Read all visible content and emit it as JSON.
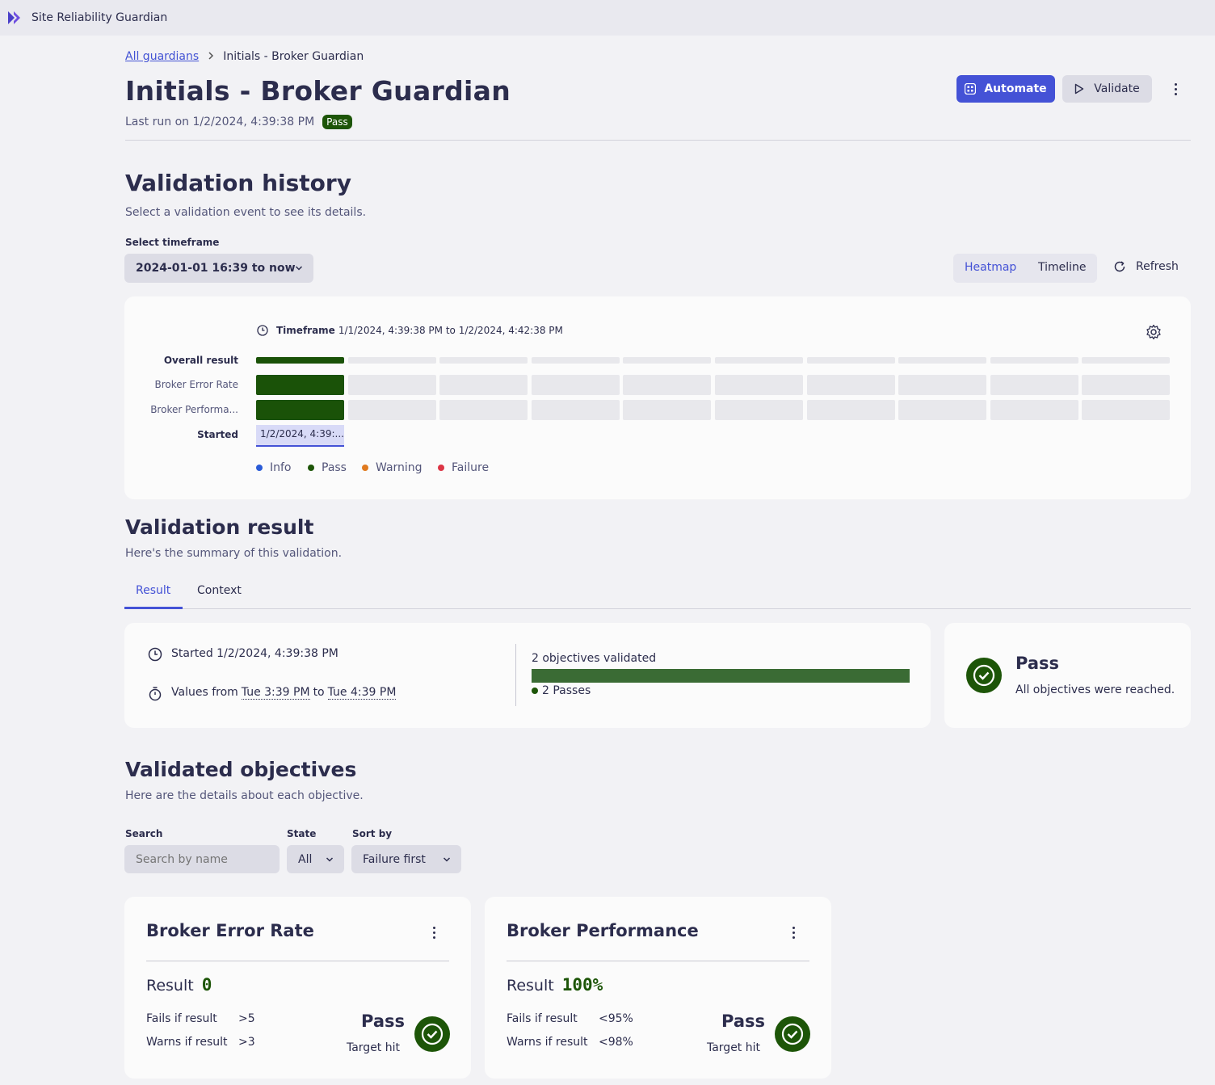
{
  "app": {
    "title": "Site Reliability Guardian"
  },
  "breadcrumb": {
    "parent": "All guardians",
    "current": "Initials - Broker Guardian"
  },
  "header": {
    "title": "Initials - Broker Guardian",
    "last_run": "Last run on 1/2/2024, 4:39:38 PM",
    "status": "Pass",
    "automate_label": "Automate",
    "validate_label": "Validate"
  },
  "history": {
    "title": "Validation history",
    "subtitle": "Select a validation event to see its details.",
    "timeframe_label": "Select timeframe",
    "timeframe_value": "2024-01-01 16:39 to now",
    "view_heatmap": "Heatmap",
    "view_timeline": "Timeline",
    "refresh": "Refresh",
    "timeframe_prefix": "Timeframe",
    "timeframe_range": "1/1/2024, 4:39:38 PM to 1/2/2024, 4:42:38 PM",
    "rows": [
      "Overall result",
      "Broker Error Rate",
      "Broker Performa..."
    ],
    "started_label": "Started",
    "started_value": "1/2/2024, 4:39:...",
    "legend": [
      {
        "label": "Info",
        "color": "#2a5bd7"
      },
      {
        "label": "Pass",
        "color": "#1d5508"
      },
      {
        "label": "Warning",
        "color": "#e07a1f"
      },
      {
        "label": "Failure",
        "color": "#dc3545"
      }
    ]
  },
  "result": {
    "title": "Validation result",
    "subtitle": "Here's the summary of this validation.",
    "tabs": [
      "Result",
      "Context"
    ],
    "started": "Started 1/2/2024, 4:39:38 PM",
    "values_prefix": "Values from",
    "values_from": "Tue 3:39 PM",
    "values_to_word": "to",
    "values_to": "Tue 4:39 PM",
    "objectives_validated": "2 objectives validated",
    "passes": "2 Passes",
    "status": "Pass",
    "status_detail": "All objectives were reached."
  },
  "objectives": {
    "title": "Validated objectives",
    "subtitle": "Here are the details about each objective.",
    "search_label": "Search",
    "search_placeholder": "Search by name",
    "state_label": "State",
    "state_value": "All",
    "sort_label": "Sort by",
    "sort_value": "Failure first",
    "items": [
      {
        "name": "Broker Error Rate",
        "result_label": "Result",
        "result_value": "0",
        "fails_label": "Fails if result",
        "fails_value": ">5",
        "warns_label": "Warns if result",
        "warns_value": ">3",
        "status": "Pass",
        "status_detail": "Target hit"
      },
      {
        "name": "Broker Performance",
        "result_label": "Result",
        "result_value": "100%",
        "fails_label": "Fails if result",
        "fails_value": "<95%",
        "warns_label": "Warns if result",
        "warns_value": "<98%",
        "status": "Pass",
        "status_detail": "Target hit"
      }
    ]
  },
  "colors": {
    "accent": "#4452d6",
    "pass": "#1d5508",
    "bar_pass": "#3a6b34"
  }
}
